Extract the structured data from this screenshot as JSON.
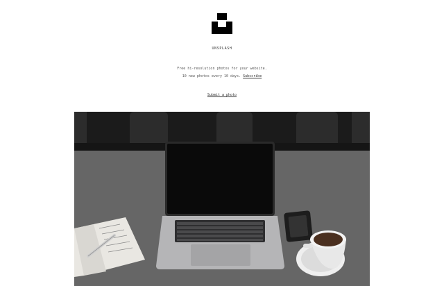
{
  "brand": {
    "logo_icon": "unsplash-logo-icon",
    "name": "UNSPLASH"
  },
  "tagline": "Free hi-resolution photos for your website.",
  "subscription": {
    "text": "10 new photos every 10 days.",
    "link_label": "Subscribe"
  },
  "submit_link": "Submit a photo",
  "photo": {
    "icon": "laptop-coffee-notebook-photo"
  },
  "colors": {
    "background": "#ffffff",
    "text": "#333333",
    "logo": "#000000"
  }
}
